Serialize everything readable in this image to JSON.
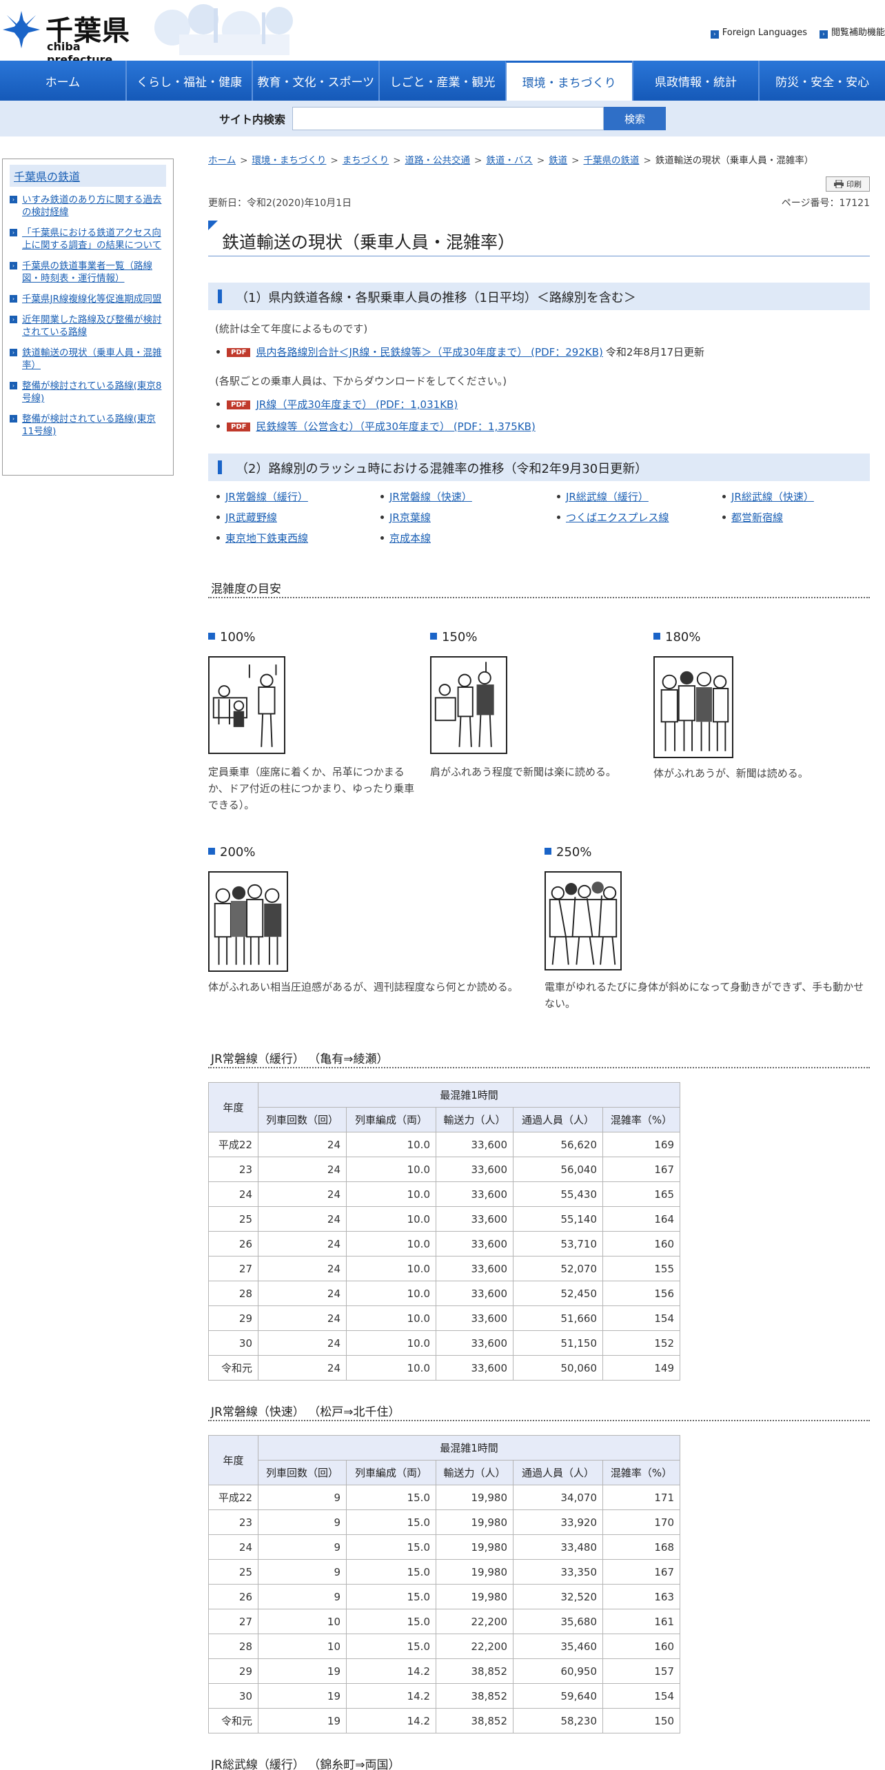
{
  "header": {
    "logo_title": "千葉県",
    "logo_sub": "chiba prefecture",
    "links": [
      "Foreign Languages",
      "閲覧補助機能"
    ]
  },
  "gnav": [
    "ホーム",
    "くらし・福祉・健康",
    "教育・文化・スポーツ",
    "しごと・産業・観光",
    "環境・まちづくり",
    "県政情報・統計",
    "防災・安全・安心"
  ],
  "search": {
    "label": "サイト内検索",
    "placeholder": "",
    "button": "検索"
  },
  "sidebar": {
    "title": "千葉県の鉄道",
    "items": [
      "いすみ鉄道のあり方に関する過去の検討経緯",
      "「千葉県における鉄道アクセス向上に関する調査」の結果について",
      "千葉県の鉄道事業者一覧（路線図・時刻表・運行情報）",
      "千葉県JR線複線化等促進期成同盟",
      "近年開業した路線及び整備が検討されている路線",
      "鉄道輸送の現状（乗車人員・混雑率）",
      "整備が検討されている路線(東京8号線)",
      "整備が検討されている路線(東京11号線)"
    ]
  },
  "breadcrumb": [
    "ホーム",
    "環境・まちづくり",
    "まちづくり",
    "道路・公共交通",
    "鉄道・バス",
    "鉄道",
    "千葉県の鉄道",
    "鉄道輸送の現状（乗車人員・混雑率）"
  ],
  "print_label": "印刷",
  "updated": "更新日：令和2(2020)年10月1日",
  "page_no": "ページ番号：17121",
  "title": "鉄道輸送の現状（乗車人員・混雑率）",
  "section1": {
    "heading": "（1）県内鉄道各線・各駅乗車人員の推移（1日平均）＜路線別を含む＞",
    "note1": "(統計は全て年度によるものです)",
    "download1": {
      "tag": "PDF",
      "label": "県内各路線別合計＜JR線・民鉄線等＞（平成30年度まで） (PDF：292KB)",
      "date": "令和2年8月17日更新"
    },
    "note2": "(各駅ごとの乗車人員は、下からダウンロードをしてください。)",
    "download2": {
      "tag": "PDF",
      "label": "JR線（平成30年度まで） (PDF：1,031KB)"
    },
    "download3": {
      "tag": "PDF",
      "label": "民鉄線等（公営含む）（平成30年度まで） (PDF：1,375KB)"
    }
  },
  "section2": {
    "heading": "（2）路線別のラッシュ時における混雑率の推移（令和2年9月30日更新）",
    "routes": [
      "JR常磐線（緩行）",
      "JR常磐線（快速）",
      "JR総武線（緩行）",
      "JR総武線（快速）",
      "JR武蔵野線",
      "JR京葉線",
      "つくばエクスプレス線",
      "都営新宿線",
      "東京地下鉄東西線",
      "京成本線"
    ]
  },
  "guide": {
    "heading": "混雑度の目安",
    "levels": [
      {
        "label": "100%",
        "desc": "定員乗車（座席に着くか、吊革につかまるか、ドア付近の柱につかまり、ゆったり乗車できる）。"
      },
      {
        "label": "150%",
        "desc": "肩がふれあう程度で新聞は楽に読める。"
      },
      {
        "label": "180%",
        "desc": "体がふれあうが、新聞は読める。"
      },
      {
        "label": "200%",
        "desc": "体がふれあい相当圧迫感があるが、週刊誌程度なら何とか読める。"
      },
      {
        "label": "250%",
        "desc": "電車がゆれるたびに身体が斜めになって身動きができず、手も動かせない。"
      }
    ]
  },
  "table_headers": {
    "year": "年度",
    "group": "最混雑1時間",
    "cols": [
      "列車回数（回）",
      "列車編成（両）",
      "輸送力（人）",
      "通過人員（人）",
      "混雑率（%）"
    ]
  },
  "table1": {
    "heading": "JR常磐線（緩行） （亀有⇒綾瀬）",
    "rows": [
      [
        "平成22",
        "24",
        "10.0",
        "33,600",
        "56,620",
        "169"
      ],
      [
        "23",
        "24",
        "10.0",
        "33,600",
        "56,040",
        "167"
      ],
      [
        "24",
        "24",
        "10.0",
        "33,600",
        "55,430",
        "165"
      ],
      [
        "25",
        "24",
        "10.0",
        "33,600",
        "55,140",
        "164"
      ],
      [
        "26",
        "24",
        "10.0",
        "33,600",
        "53,710",
        "160"
      ],
      [
        "27",
        "24",
        "10.0",
        "33,600",
        "52,070",
        "155"
      ],
      [
        "28",
        "24",
        "10.0",
        "33,600",
        "52,450",
        "156"
      ],
      [
        "29",
        "24",
        "10.0",
        "33,600",
        "51,660",
        "154"
      ],
      [
        "30",
        "24",
        "10.0",
        "33,600",
        "51,150",
        "152"
      ],
      [
        "令和元",
        "24",
        "10.0",
        "33,600",
        "50,060",
        "149"
      ]
    ]
  },
  "table2": {
    "heading": "JR常磐線（快速） （松戸⇒北千住）",
    "rows": [
      [
        "平成22",
        "9",
        "15.0",
        "19,980",
        "34,070",
        "171"
      ],
      [
        "23",
        "9",
        "15.0",
        "19,980",
        "33,920",
        "170"
      ],
      [
        "24",
        "9",
        "15.0",
        "19,980",
        "33,480",
        "168"
      ],
      [
        "25",
        "9",
        "15.0",
        "19,980",
        "33,350",
        "167"
      ],
      [
        "26",
        "9",
        "15.0",
        "19,980",
        "32,520",
        "163"
      ],
      [
        "27",
        "10",
        "15.0",
        "22,200",
        "35,680",
        "161"
      ],
      [
        "28",
        "10",
        "15.0",
        "22,200",
        "35,460",
        "160"
      ],
      [
        "29",
        "19",
        "14.2",
        "38,852",
        "60,950",
        "157"
      ],
      [
        "30",
        "19",
        "14.2",
        "38,852",
        "59,640",
        "154"
      ],
      [
        "令和元",
        "19",
        "14.2",
        "38,852",
        "58,230",
        "150"
      ]
    ]
  },
  "table3": {
    "heading": "JR総武線（緩行） （錦糸町⇒両国）"
  }
}
